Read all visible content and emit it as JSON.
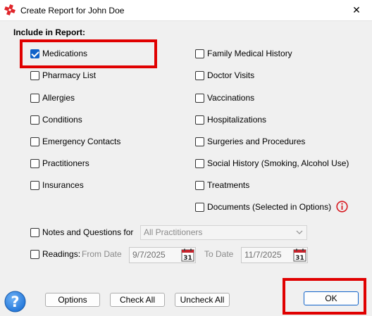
{
  "window": {
    "title": "Create Report for John Doe",
    "close_glyph": "✕"
  },
  "section_label": "Include in Report:",
  "left_options": [
    {
      "label": "Medications",
      "checked": true
    },
    {
      "label": "Pharmacy List",
      "checked": false
    },
    {
      "label": "Allergies",
      "checked": false
    },
    {
      "label": "Conditions",
      "checked": false
    },
    {
      "label": "Emergency Contacts",
      "checked": false
    },
    {
      "label": "Practitioners",
      "checked": false
    },
    {
      "label": "Insurances",
      "checked": false
    }
  ],
  "right_options": [
    {
      "label": "Family Medical History",
      "checked": false
    },
    {
      "label": "Doctor Visits",
      "checked": false
    },
    {
      "label": "Vaccinations",
      "checked": false
    },
    {
      "label": "Hospitalizations",
      "checked": false
    },
    {
      "label": "Surgeries and Procedures",
      "checked": false
    },
    {
      "label": "Social History (Smoking, Alcohol Use)",
      "checked": false
    },
    {
      "label": "Treatments",
      "checked": false
    },
    {
      "label": "Documents (Selected in Options)",
      "checked": false
    }
  ],
  "notes": {
    "label": "Notes and Questions for",
    "checked": false,
    "selected": "All Practitioners"
  },
  "readings": {
    "label": "Readings:",
    "checked": false,
    "from_label": "From Date",
    "from_value": "9/7/2025",
    "to_label": "To Date",
    "to_value": "11/7/2025",
    "calendar_day": "31"
  },
  "buttons": {
    "options": "Options",
    "check_all": "Check All",
    "uncheck_all": "Uncheck All",
    "ok": "OK"
  },
  "icons": {
    "help_glyph": "?",
    "info_glyph": "i",
    "app": "red-cross-icon"
  },
  "colors": {
    "accent": "#0f62c9",
    "highlight": "#e00000",
    "info": "#d71920",
    "help": "#1e73d8"
  }
}
